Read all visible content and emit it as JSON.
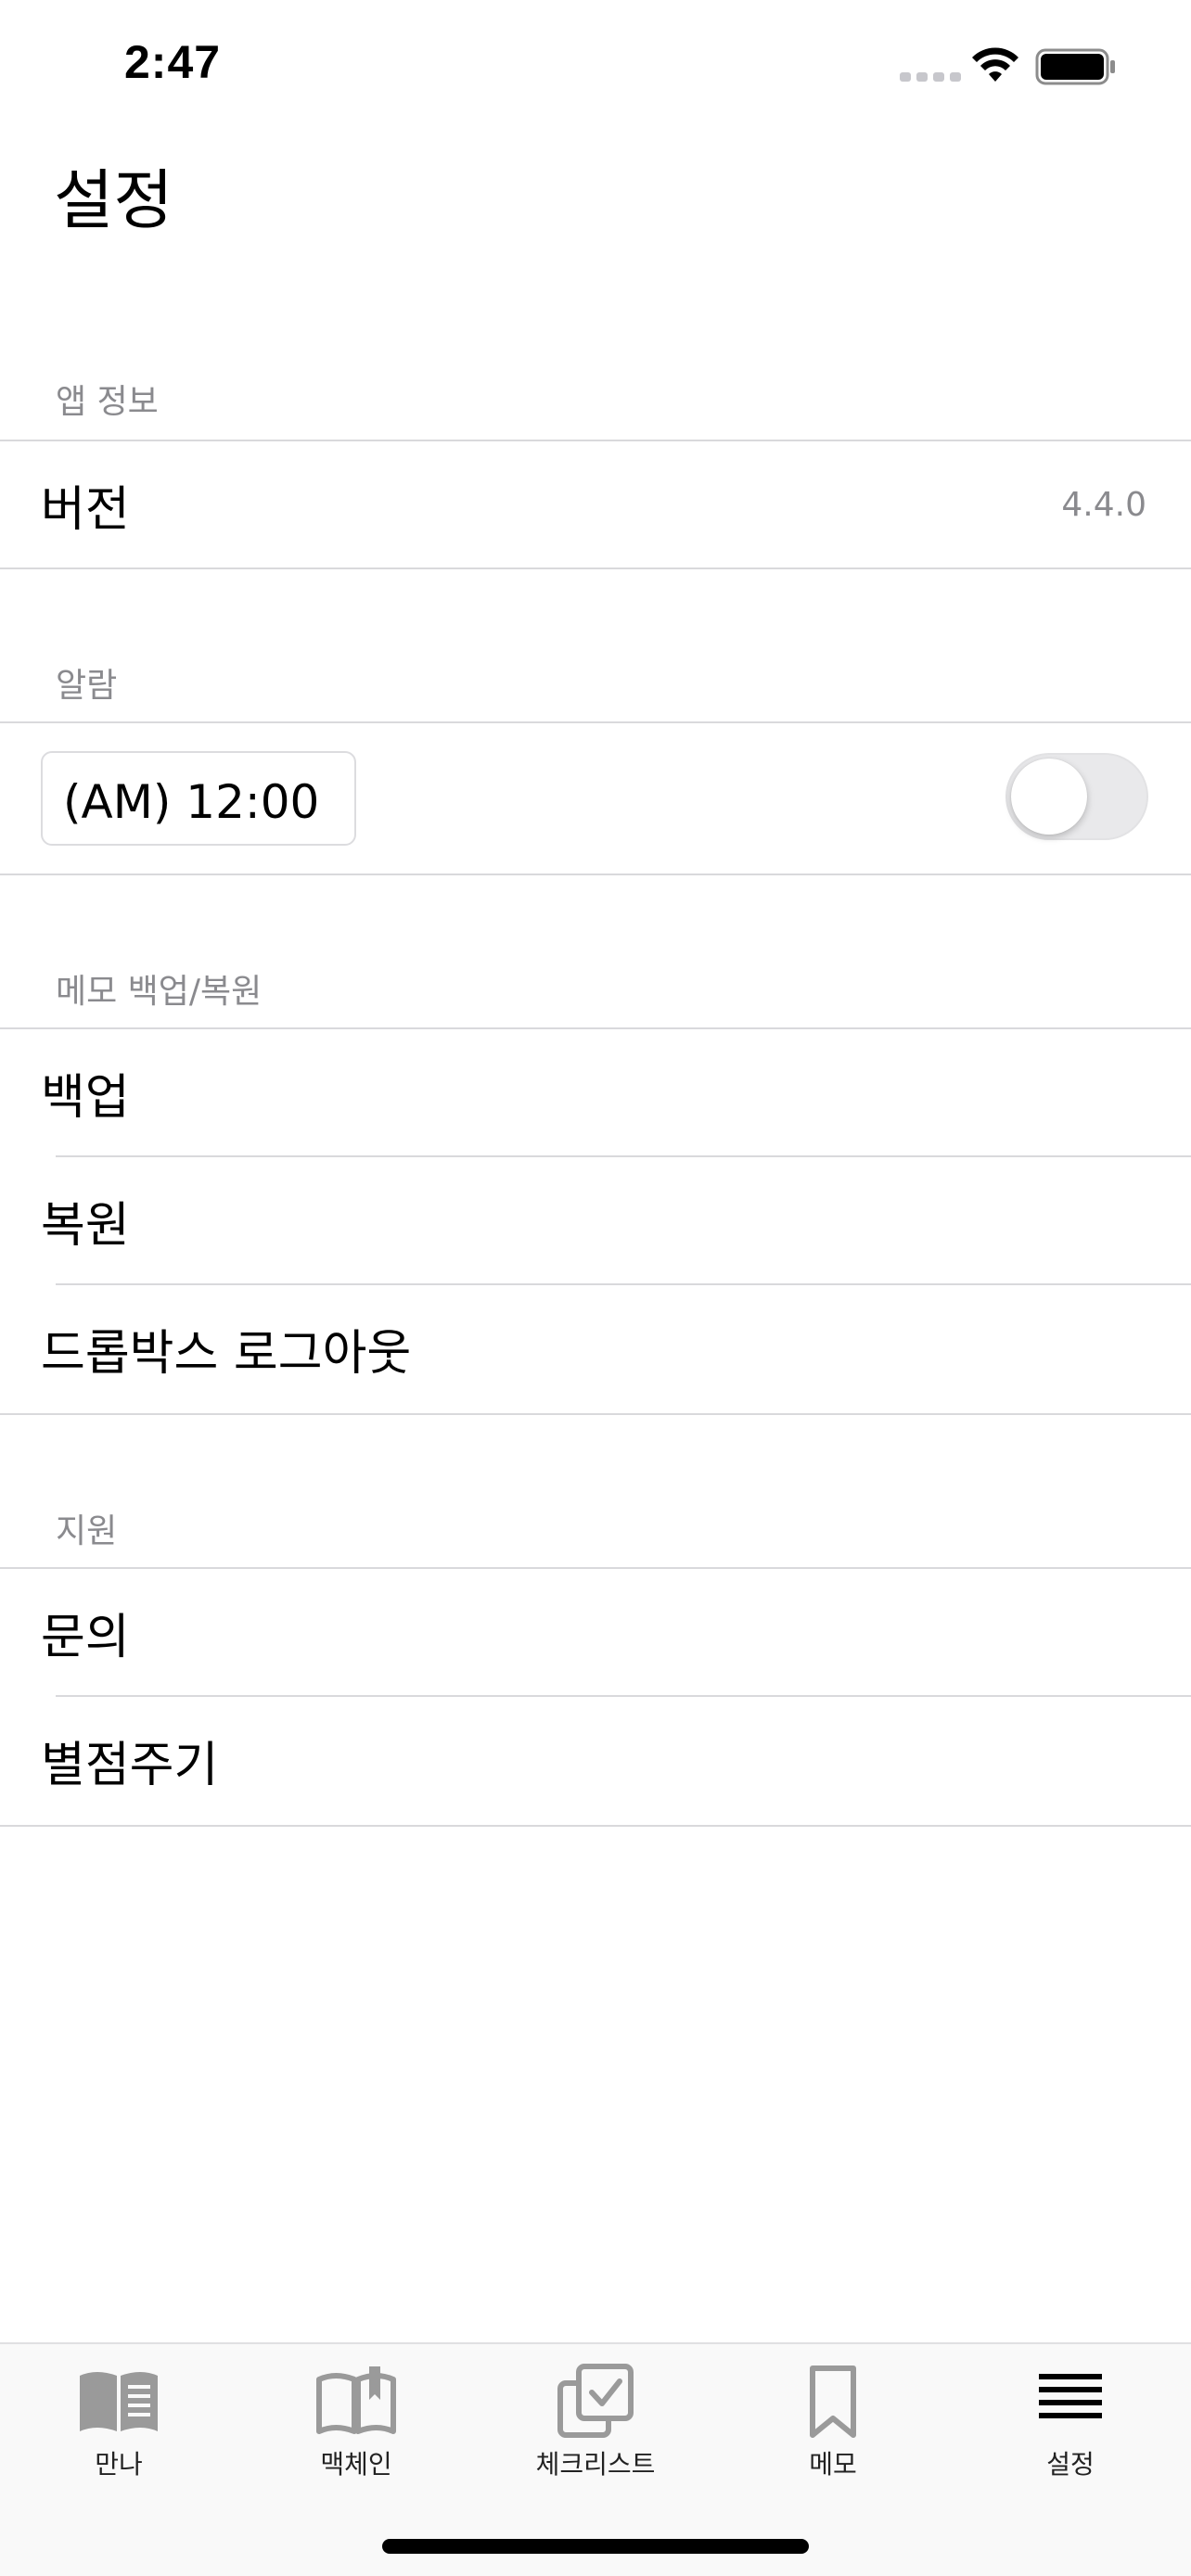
{
  "status_bar": {
    "time": "2:47"
  },
  "page_title": "설정",
  "sections": {
    "app_info": {
      "header": "앱 정보",
      "version_label": "버전",
      "version_value": "4.4.0"
    },
    "alarm": {
      "header": "알람",
      "time_value": "(AM) 12:00",
      "toggle_on": false
    },
    "backup": {
      "header": "메모 백업/복원",
      "items": [
        "백업",
        "복원",
        "드롭박스 로그아웃"
      ]
    },
    "support": {
      "header": "지원",
      "items": [
        "문의",
        "별점주기"
      ]
    }
  },
  "tab_bar": {
    "items": [
      {
        "label": "만나",
        "icon": "open-book-icon"
      },
      {
        "label": "맥체인",
        "icon": "book-bookmark-icon"
      },
      {
        "label": "체크리스트",
        "icon": "checklist-icon"
      },
      {
        "label": "메모",
        "icon": "bookmark-icon"
      },
      {
        "label": "설정",
        "icon": "menu-lines-icon",
        "selected": true
      }
    ]
  },
  "colors": {
    "secondary_text": "#8a8a8e",
    "separator": "#d9d9dc",
    "tab_icon_inactive": "#9a9a9a",
    "tab_icon_active": "#000000"
  }
}
